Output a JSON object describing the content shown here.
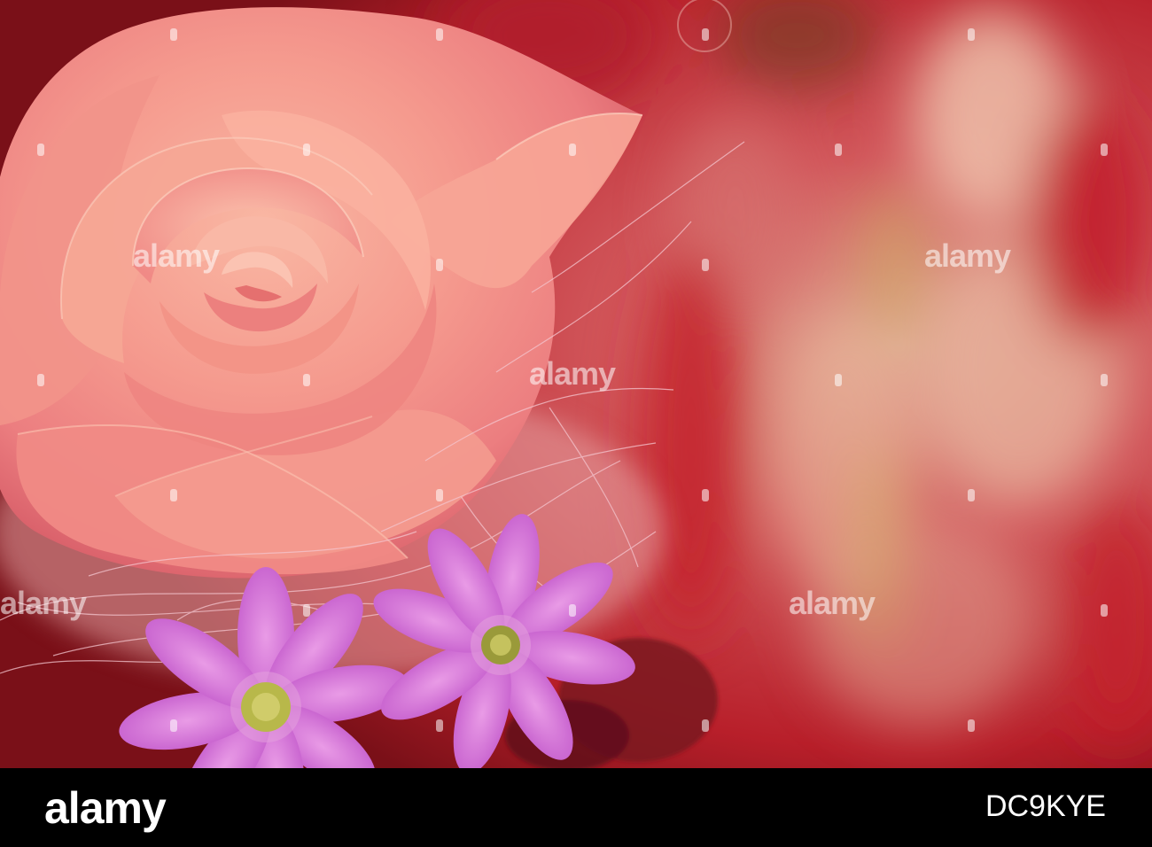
{
  "photo": {
    "subject": "pink-rose-with-purple-daisies",
    "colors": {
      "rose": "#f59a8e",
      "rose_shadow": "#d9606a",
      "daisy": "#d374d8",
      "daisy_center": "#b8b84a",
      "background_red": "#c8262e",
      "background_warm": "#e8b49a"
    }
  },
  "watermark": {
    "text": "alamy"
  },
  "footer": {
    "logo": "alamy",
    "image_id": "DC9KYE"
  }
}
